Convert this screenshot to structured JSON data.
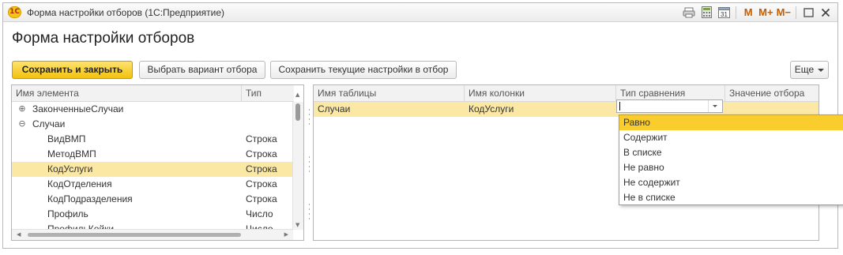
{
  "window": {
    "title": "Форма настройки отборов (1С:Предприятие)",
    "logo_text": "1С"
  },
  "titlebar_tools": {
    "m": "M",
    "m_plus": "M+",
    "m_minus": "M−",
    "calendar_day": "31"
  },
  "form": {
    "title": "Форма настройки отборов"
  },
  "toolbar": {
    "save_close": "Сохранить и закрыть",
    "choose_variant": "Выбрать вариант отбора",
    "save_current": "Сохранить текущие настройки в отбор",
    "more": "Еще"
  },
  "tree": {
    "columns": [
      "Имя элемента",
      "Тип"
    ],
    "rows": [
      {
        "name": "ЗаконченныеСлучаи",
        "type": "",
        "level": 0,
        "expander": "⊕",
        "selected": false
      },
      {
        "name": "Случаи",
        "type": "",
        "level": 0,
        "expander": "⊖",
        "selected": false
      },
      {
        "name": "ВидВМП",
        "type": "Строка",
        "level": 1,
        "expander": "",
        "selected": false
      },
      {
        "name": "МетодВМП",
        "type": "Строка",
        "level": 1,
        "expander": "",
        "selected": false
      },
      {
        "name": "КодУслуги",
        "type": "Строка",
        "level": 1,
        "expander": "",
        "selected": true
      },
      {
        "name": "КодОтделения",
        "type": "Строка",
        "level": 1,
        "expander": "",
        "selected": false
      },
      {
        "name": "КодПодразделения",
        "type": "Строка",
        "level": 1,
        "expander": "",
        "selected": false
      },
      {
        "name": "Профиль",
        "type": "Число",
        "level": 1,
        "expander": "",
        "selected": false
      },
      {
        "name": "ПрофильКойки",
        "type": "Число",
        "level": 1,
        "expander": "",
        "selected": false
      }
    ]
  },
  "filters": {
    "columns": [
      "Имя таблицы",
      "Имя колонки",
      "Тип сравнения",
      "Значение отбора"
    ],
    "rows": [
      {
        "table": "Случаи",
        "column": "КодУслуги",
        "comparison": "",
        "value": ""
      }
    ]
  },
  "comparison_options": [
    "Равно",
    "Содержит",
    "В списке",
    "Не равно",
    "Не содержит",
    "Не в списке"
  ],
  "comparison_highlighted": 0,
  "colors": {
    "accent": "#f3c10e",
    "selected_row": "#fbe8a5",
    "dropdown_active": "#f9cd2e"
  }
}
